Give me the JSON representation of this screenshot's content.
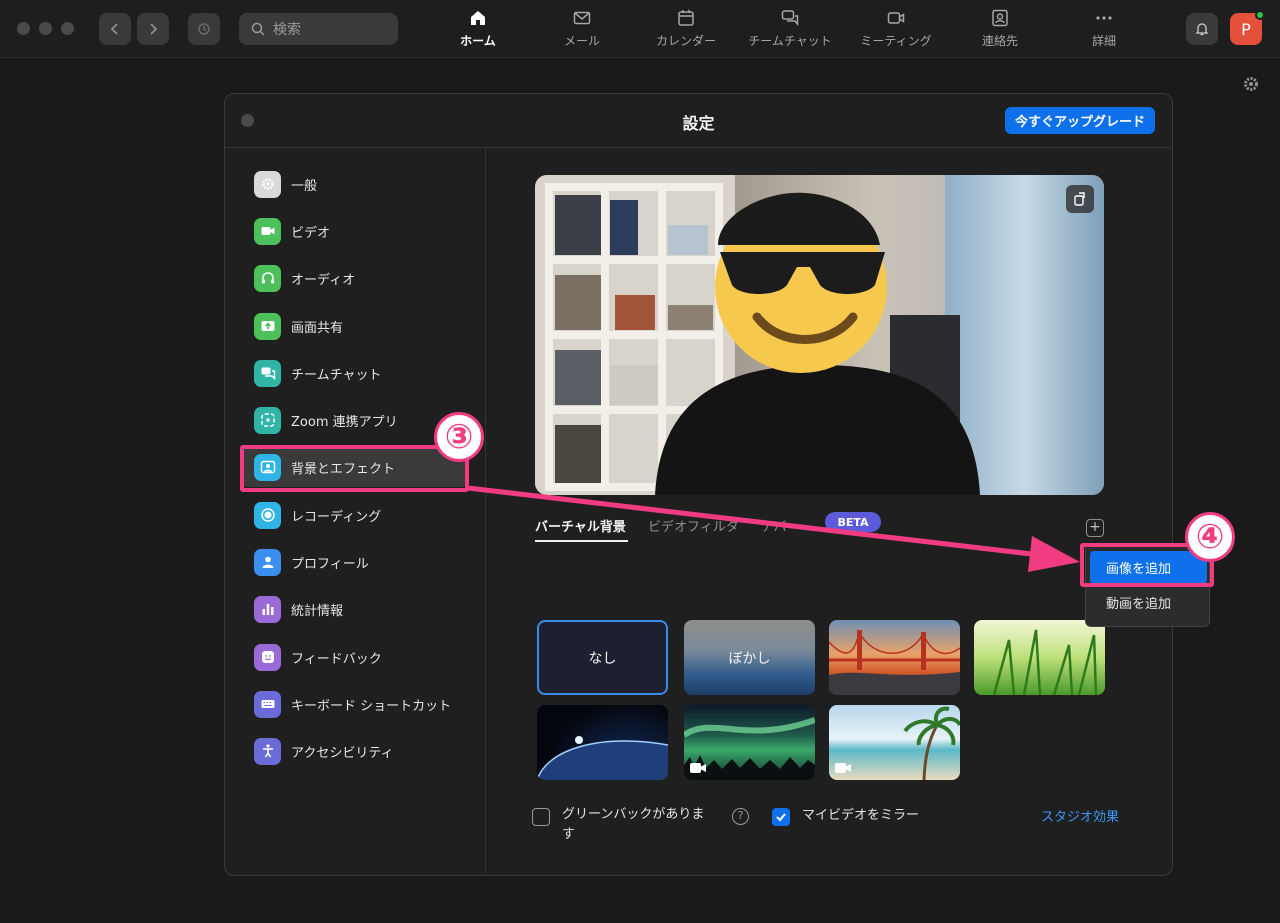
{
  "topbar": {
    "search_placeholder": "検索",
    "tabs": [
      {
        "label": "ホーム",
        "icon": "home-icon"
      },
      {
        "label": "メール",
        "icon": "mail-icon"
      },
      {
        "label": "カレンダー",
        "icon": "calendar-icon"
      },
      {
        "label": "チームチャット",
        "icon": "chat-icon"
      },
      {
        "label": "ミーティング",
        "icon": "video-icon"
      },
      {
        "label": "連絡先",
        "icon": "contacts-icon"
      },
      {
        "label": "詳細",
        "icon": "more-icon"
      }
    ],
    "active_tab": "ホーム",
    "avatar_initial": "P"
  },
  "settings": {
    "title": "設定",
    "upgrade_label": "今すぐアップグレード",
    "sidebar": [
      {
        "label": "一般",
        "icon": "gear-icon",
        "color": "#d9d9d9"
      },
      {
        "label": "ビデオ",
        "icon": "video-icon",
        "color": "#4cc05a"
      },
      {
        "label": "オーディオ",
        "icon": "headphones-icon",
        "color": "#4cc05a"
      },
      {
        "label": "画面共有",
        "icon": "share-screen-icon",
        "color": "#4cc05a"
      },
      {
        "label": "チームチャット",
        "icon": "chat-icon",
        "color": "#2fb4a6"
      },
      {
        "label": "Zoom 連携アプリ",
        "icon": "apps-icon",
        "color": "#2fb4a6"
      },
      {
        "label": "背景とエフェクト",
        "icon": "background-icon",
        "color": "#2fb4e6"
      },
      {
        "label": "レコーディング",
        "icon": "record-icon",
        "color": "#2fb4e6"
      },
      {
        "label": "プロフィール",
        "icon": "profile-icon",
        "color": "#3b8ff0"
      },
      {
        "label": "統計情報",
        "icon": "stats-icon",
        "color": "#9a6bd8"
      },
      {
        "label": "フィードバック",
        "icon": "feedback-icon",
        "color": "#9a6bd8"
      },
      {
        "label": "キーボード ショートカット",
        "icon": "keyboard-icon",
        "color": "#6b6bd8"
      },
      {
        "label": "アクセシビリティ",
        "icon": "accessibility-icon",
        "color": "#6b6bd8"
      }
    ],
    "active_item": "背景とエフェクト",
    "tabs": {
      "virtual_bg": "バーチャル背景",
      "video_filter": "ビデオフィルタ",
      "avatar_partial": "アバ",
      "beta": "BETA"
    },
    "backgrounds": [
      {
        "label": "なし",
        "selected": true
      },
      {
        "label": "ぼかし"
      },
      {
        "name": "golden-gate"
      },
      {
        "name": "grass"
      },
      {
        "name": "earth"
      },
      {
        "name": "aurora",
        "video": true
      },
      {
        "name": "beach",
        "video": true
      }
    ],
    "options": {
      "green_screen": "グリーンバックがあります",
      "green_screen_checked": false,
      "mirror_video": "マイビデオをミラー",
      "mirror_video_checked": true,
      "studio_effects": "スタジオ効果"
    }
  },
  "add_menu": {
    "add_image": "画像を追加",
    "add_video": "動画を追加"
  },
  "annotations": {
    "step3": "③",
    "step4": "④",
    "highlight_color": "#f23c82"
  }
}
